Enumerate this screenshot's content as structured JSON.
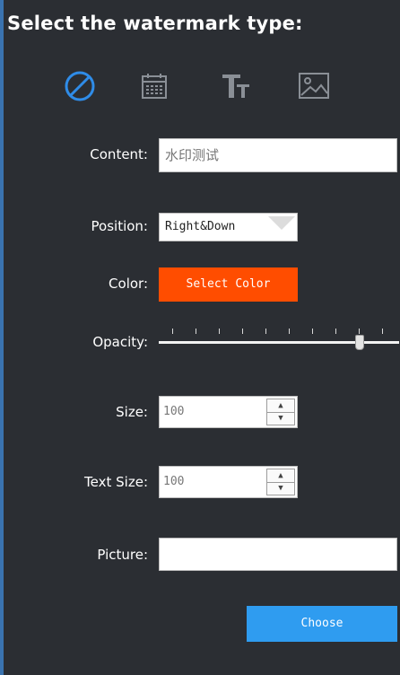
{
  "panel": {
    "title": "Select the watermark type:",
    "accent_color": "#3a73b0",
    "background_color": "#2b2e33"
  },
  "type_icons": [
    {
      "name": "none-icon",
      "selected": true,
      "color": "#2f8ce8"
    },
    {
      "name": "calendar-icon",
      "selected": false
    },
    {
      "name": "text-icon",
      "selected": false
    },
    {
      "name": "picture-icon",
      "selected": false
    }
  ],
  "content": {
    "label": "Content:",
    "value": "水印测试"
  },
  "position": {
    "label": "Position:",
    "value": "Right&Down"
  },
  "color": {
    "label": "Color:",
    "button_label": "Select Color",
    "swatch": "#ff4d00"
  },
  "opacity": {
    "label": "Opacity:",
    "value_fraction": 0.85
  },
  "size": {
    "label": "Size:",
    "value": "100"
  },
  "text_size": {
    "label": "Text Size:",
    "value": "100"
  },
  "picture": {
    "label": "Picture:",
    "value": ""
  },
  "choose": {
    "label": "Choose",
    "color": "#2f9cf0"
  }
}
